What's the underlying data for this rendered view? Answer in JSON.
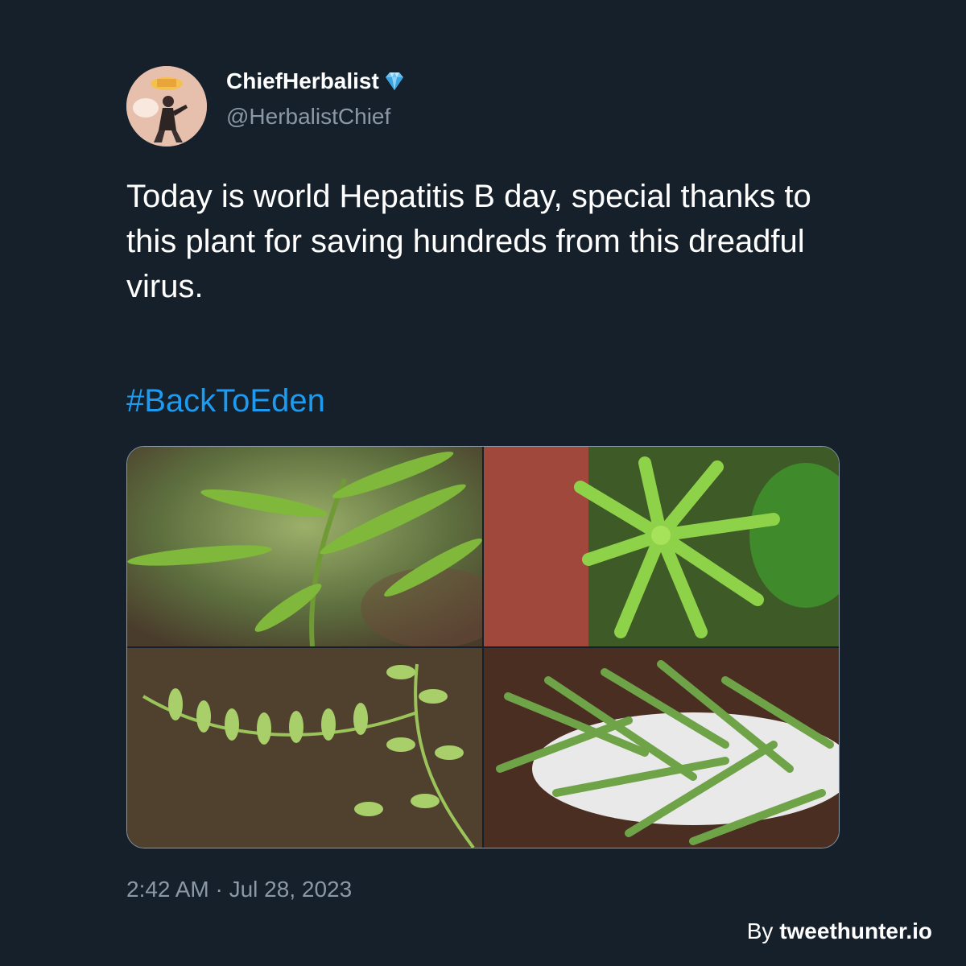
{
  "tweet": {
    "author": {
      "display_name": "ChiefHerbalist",
      "verified_icon": "gem-icon",
      "handle": "@HerbalistChief"
    },
    "text": "Today is world Hepatitis B day, special thanks to this plant for saving hundreds from this dreadful virus.",
    "hashtag": "#BackToEden",
    "media": [
      {
        "description": "leafy-plant-closeup"
      },
      {
        "description": "plant-top-view"
      },
      {
        "description": "leaf-stem-with-seeds"
      },
      {
        "description": "harvested-plant-on-plate"
      }
    ],
    "timestamp": "2:42 AM · Jul 28, 2023"
  },
  "credit": {
    "prefix": "By",
    "brand": "tweethunter.io"
  },
  "colors": {
    "background": "#15202b",
    "text": "#ffffff",
    "secondary": "#8b98a5",
    "link": "#1d9bf0"
  }
}
